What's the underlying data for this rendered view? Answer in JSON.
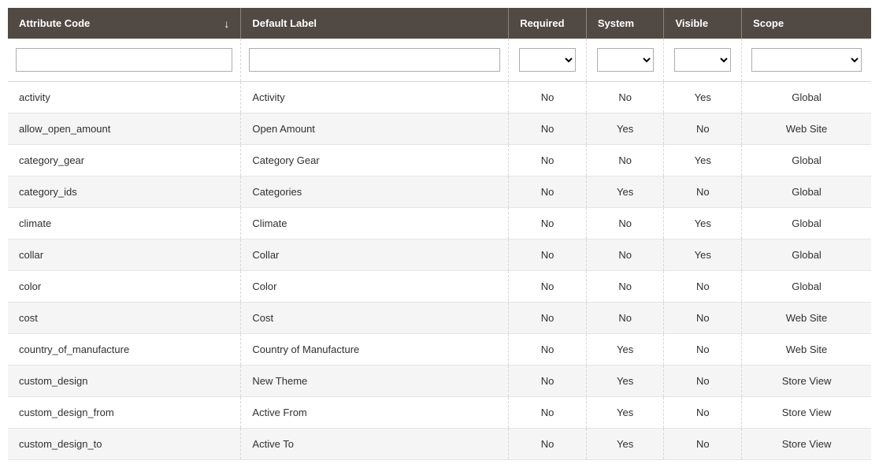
{
  "columns": {
    "code": {
      "label": "Attribute Code",
      "sorted": "asc"
    },
    "label": {
      "label": "Default Label"
    },
    "required": {
      "label": "Required"
    },
    "system": {
      "label": "System"
    },
    "visible": {
      "label": "Visible"
    },
    "scope": {
      "label": "Scope"
    }
  },
  "filters": {
    "code": "",
    "label": "",
    "required": "",
    "system": "",
    "visible": "",
    "scope": ""
  },
  "rows": [
    {
      "code": "activity",
      "label": "Activity",
      "required": "No",
      "system": "No",
      "visible": "Yes",
      "scope": "Global"
    },
    {
      "code": "allow_open_amount",
      "label": "Open Amount",
      "required": "No",
      "system": "Yes",
      "visible": "No",
      "scope": "Web Site"
    },
    {
      "code": "category_gear",
      "label": "Category Gear",
      "required": "No",
      "system": "No",
      "visible": "Yes",
      "scope": "Global"
    },
    {
      "code": "category_ids",
      "label": "Categories",
      "required": "No",
      "system": "Yes",
      "visible": "No",
      "scope": "Global"
    },
    {
      "code": "climate",
      "label": "Climate",
      "required": "No",
      "system": "No",
      "visible": "Yes",
      "scope": "Global"
    },
    {
      "code": "collar",
      "label": "Collar",
      "required": "No",
      "system": "No",
      "visible": "Yes",
      "scope": "Global"
    },
    {
      "code": "color",
      "label": "Color",
      "required": "No",
      "system": "No",
      "visible": "No",
      "scope": "Global"
    },
    {
      "code": "cost",
      "label": "Cost",
      "required": "No",
      "system": "No",
      "visible": "No",
      "scope": "Web Site"
    },
    {
      "code": "country_of_manufacture",
      "label": "Country of Manufacture",
      "required": "No",
      "system": "Yes",
      "visible": "No",
      "scope": "Web Site"
    },
    {
      "code": "custom_design",
      "label": "New Theme",
      "required": "No",
      "system": "Yes",
      "visible": "No",
      "scope": "Store View"
    },
    {
      "code": "custom_design_from",
      "label": "Active From",
      "required": "No",
      "system": "Yes",
      "visible": "No",
      "scope": "Store View"
    },
    {
      "code": "custom_design_to",
      "label": "Active To",
      "required": "No",
      "system": "Yes",
      "visible": "No",
      "scope": "Store View"
    }
  ]
}
